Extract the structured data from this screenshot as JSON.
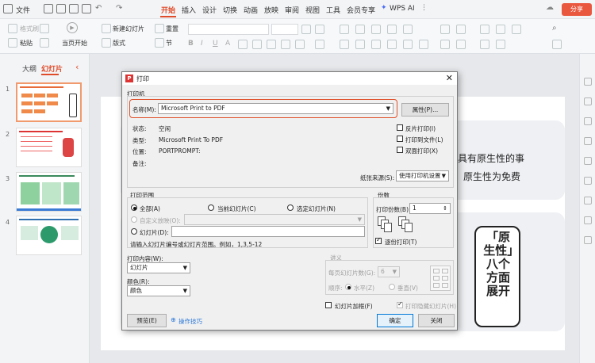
{
  "menubar": {
    "file": "文件",
    "tabs": [
      "开始",
      "插入",
      "设计",
      "切换",
      "动画",
      "放映",
      "审阅",
      "视图",
      "工具",
      "会员专享"
    ],
    "wps_ai": "WPS AI",
    "share": "分享"
  },
  "ribbon": {
    "format_painter": "格式刷",
    "paste": "粘贴",
    "from_current": "当页开始",
    "new_slide": "新建幻灯片",
    "layout": "版式",
    "reset": "重置",
    "section": "节"
  },
  "leftpanel": {
    "tab_outline": "大纲",
    "tab_slides": "幻灯片",
    "slide_numbers": [
      "1",
      "2",
      "3",
      "4"
    ]
  },
  "slide": {
    "text1": "具有原生性的事",
    "text2": "原生性为免费",
    "vertical_card": "「原生性」八个方面展开"
  },
  "dialog": {
    "title": "打印",
    "printer_group": "打印机",
    "name_label": "名称(M):",
    "printer_name": "Microsoft Print to PDF",
    "properties_button": "属性(P)...",
    "status_label": "状态:",
    "status_value": "空闲",
    "type_label": "类型:",
    "type_value": "Microsoft Print To PDF",
    "location_label": "位置:",
    "location_value": "PORTPROMPT:",
    "comment_label": "备注:",
    "reverse_print": "反片打印(I)",
    "print_to_file": "打印到文件(L)",
    "duplex": "双面打印(X)",
    "paper_source_label": "纸张来源(S):",
    "paper_source_value": "使用打印机设置",
    "range_group": "打印范围",
    "range_all": "全部(A)",
    "range_current": "当前幻灯片(C)",
    "range_selection": "选定幻灯片(N)",
    "range_custom": "自定义放映(O):",
    "range_slides": "幻灯片(D):",
    "range_hint": "请输入幻灯片编号或幻灯片范围。例如，1,3,5-12",
    "copies_group": "份数",
    "copies_label": "打印份数(B):",
    "copies_value": "1",
    "collate": "逐份打印(T)",
    "content_label": "打印内容(W):",
    "content_value": "幻灯片",
    "color_label": "颜色(R):",
    "color_value": "颜色",
    "handout_group": "讲义",
    "per_page_label": "每页幻灯片数(G):",
    "per_page_value": "6",
    "order_label": "顺序:",
    "order_horizontal": "水平(Z)",
    "order_vertical": "垂直(V)",
    "frame_slides": "幻灯片加框(F)",
    "print_hidden": "打印隐藏幻灯片(H)",
    "preview_button": "预览(E)",
    "tips_link": "操作技巧",
    "ok_button": "确定",
    "close_button": "关闭"
  }
}
